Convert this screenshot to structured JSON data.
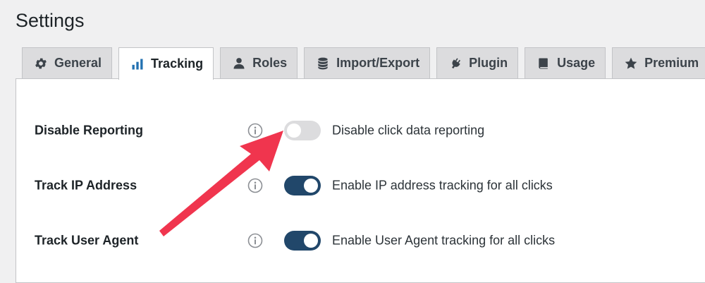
{
  "page": {
    "title": "Settings"
  },
  "tabs": [
    {
      "label": "General",
      "icon": "gear-icon",
      "active": false
    },
    {
      "label": "Tracking",
      "icon": "bar-chart-icon",
      "active": true
    },
    {
      "label": "Roles",
      "icon": "user-icon",
      "active": false
    },
    {
      "label": "Import/Export",
      "icon": "database-icon",
      "active": false
    },
    {
      "label": "Plugin",
      "icon": "plug-icon",
      "active": false
    },
    {
      "label": "Usage",
      "icon": "book-icon",
      "active": false
    },
    {
      "label": "Premium",
      "icon": "star-icon",
      "active": false
    }
  ],
  "settings": [
    {
      "label": "Disable Reporting",
      "description": "Disable click data reporting",
      "enabled": false
    },
    {
      "label": "Track IP Address",
      "description": "Enable IP address tracking for all clicks",
      "enabled": true
    },
    {
      "label": "Track User Agent",
      "description": "Enable User Agent tracking for all clicks",
      "enabled": true
    }
  ],
  "colors": {
    "toggle_on": "#21476a",
    "toggle_off": "#dcdcde",
    "annotation_arrow": "#f0354e",
    "active_tab_icon": "#2271b1"
  }
}
